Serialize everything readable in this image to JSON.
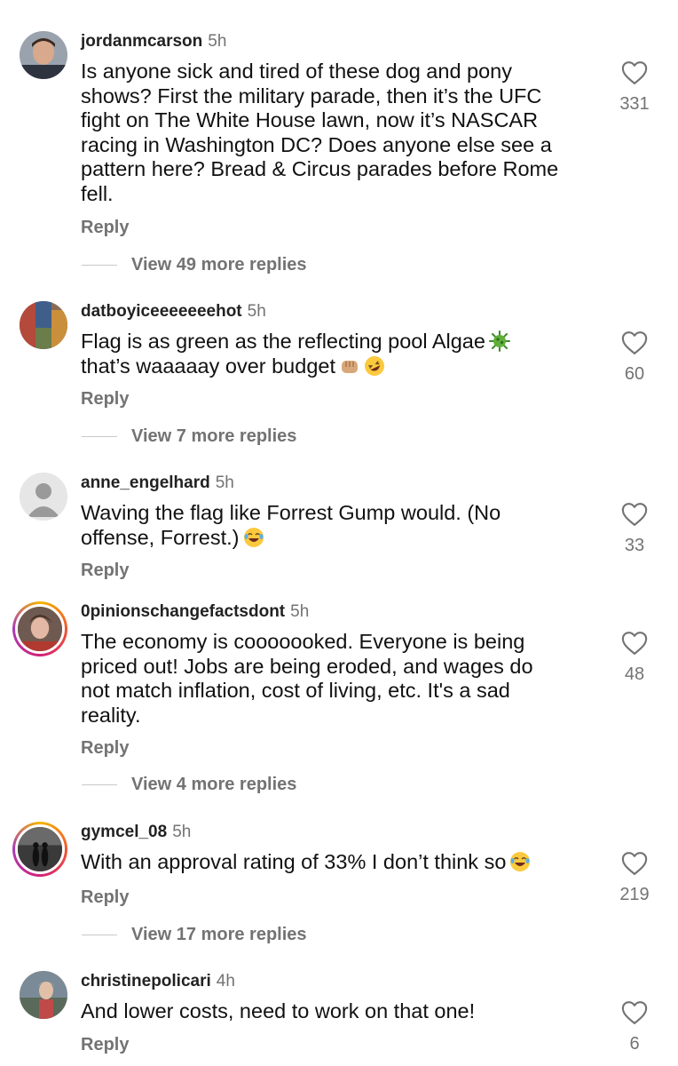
{
  "comments": [
    {
      "username": "jordanmcarson",
      "time": "5h",
      "lines": [
        "Is anyone sick and tired of these dog and pony",
        "shows? First the military parade, then it’s the UFC",
        "fight on The White House lawn, now it’s NASCAR",
        "racing in Washington DC? Does anyone else see a",
        "pattern here? Bread & Circus parades before Rome",
        "fell."
      ],
      "reply_label": "Reply",
      "view_replies": "View 49 more replies",
      "likes": "331"
    },
    {
      "username": "datboyiceeeeeeehot",
      "time": "5h",
      "lines": [
        "Flag is as green as the reflecting pool Algae",
        "that’s waaaaay over budget"
      ],
      "emojis": [
        "microbe-emoji",
        "fist-emoji",
        "rofl-emoji"
      ],
      "reply_label": "Reply",
      "view_replies": "View 7 more replies",
      "likes": "60"
    },
    {
      "username": "anne_engelhard",
      "time": "5h",
      "lines": [
        "Waving the flag like Forrest Gump would. (No",
        "offense, Forrest.)"
      ],
      "emojis": [
        "joy-emoji"
      ],
      "reply_label": "Reply",
      "likes": "33"
    },
    {
      "username": "0pinionschangefactsdont",
      "time": "5h",
      "lines": [
        "The economy is cooooooked. Everyone is being",
        "priced out! Jobs are being eroded, and wages do",
        "not match inflation, cost of living, etc. It's a sad",
        "reality."
      ],
      "reply_label": "Reply",
      "view_replies": "View 4 more replies",
      "likes": "48"
    },
    {
      "username": "gymcel_08",
      "time": "5h",
      "lines": [
        "With an approval rating of 33% I don’t think so"
      ],
      "emojis": [
        "joy-emoji"
      ],
      "reply_label": "Reply",
      "view_replies": "View 17 more replies",
      "likes": "219"
    },
    {
      "username": "christinepolicari",
      "time": "4h",
      "lines": [
        "And lower costs, need to work on that one!"
      ],
      "reply_label": "Reply",
      "likes": "6"
    }
  ],
  "colors": {
    "text": "#111111",
    "secondary": "#737373",
    "story_ring": "#d1217a"
  },
  "icons": [
    "heart-outline-icon",
    "default-avatar-icon"
  ]
}
